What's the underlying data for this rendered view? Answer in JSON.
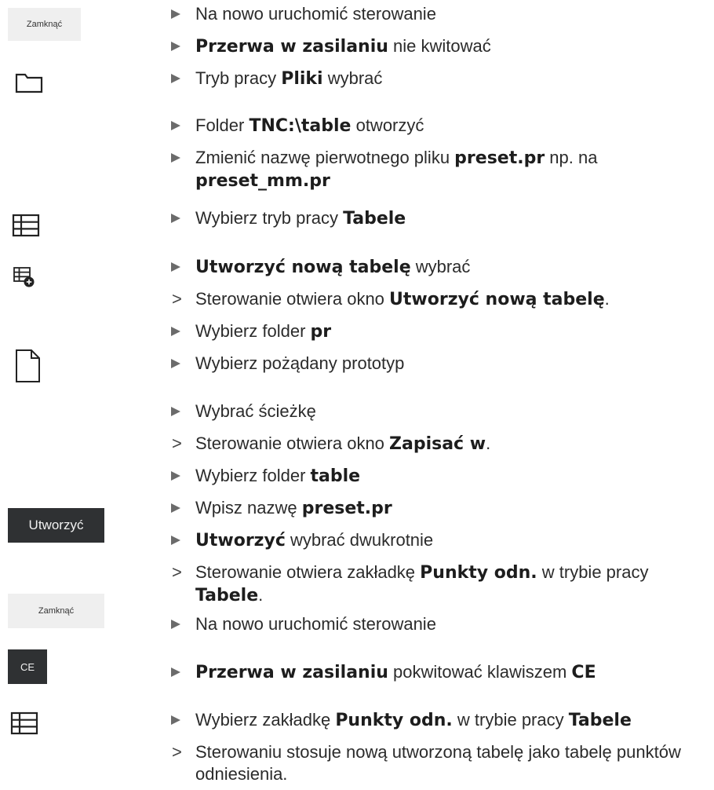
{
  "side_buttons": {
    "zamknac_1": "Zamknąć",
    "utworzyc": "Utworzyć",
    "zamknac_2": "Zamknąć",
    "ce": "CE"
  },
  "steps": [
    {
      "type": "action",
      "parts": [
        {
          "t": "Na nowo uruchomić sterowanie",
          "b": false
        }
      ]
    },
    {
      "type": "action",
      "parts": [
        {
          "t": "Przerwa w zasilaniu",
          "b": true
        },
        {
          "t": " nie kwitować",
          "b": false
        }
      ]
    },
    {
      "type": "action",
      "parts": [
        {
          "t": "Tryb pracy ",
          "b": false
        },
        {
          "t": "Pliki",
          "b": true
        },
        {
          "t": " wybrać",
          "b": false
        }
      ]
    },
    {
      "type": "action",
      "parts": [
        {
          "t": "Folder ",
          "b": false
        },
        {
          "t": "TNC:\\table",
          "b": true
        },
        {
          "t": " otworzyć",
          "b": false
        }
      ]
    },
    {
      "type": "action",
      "parts": [
        {
          "t": "Zmienić nazwę pierwotnego pliku ",
          "b": false
        },
        {
          "t": "preset.pr",
          "b": true
        },
        {
          "t": " np. na ",
          "b": false
        },
        {
          "t": "preset_mm.pr",
          "b": true
        }
      ]
    },
    {
      "type": "action",
      "parts": [
        {
          "t": "Wybierz tryb pracy ",
          "b": false
        },
        {
          "t": "Tabele",
          "b": true
        }
      ]
    },
    {
      "type": "action",
      "parts": [
        {
          "t": "Utworzyć nową tabelę",
          "b": true
        },
        {
          "t": " wybrać",
          "b": false
        }
      ]
    },
    {
      "type": "result",
      "parts": [
        {
          "t": "Sterowanie otwiera okno ",
          "b": false
        },
        {
          "t": "Utworzyć nową tabelę",
          "b": true
        },
        {
          "t": ".",
          "b": false
        }
      ]
    },
    {
      "type": "action",
      "parts": [
        {
          "t": "Wybierz folder ",
          "b": false
        },
        {
          "t": "pr",
          "b": true
        }
      ]
    },
    {
      "type": "action",
      "parts": [
        {
          "t": "Wybierz pożądany prototyp",
          "b": false
        }
      ]
    },
    {
      "type": "action",
      "parts": [
        {
          "t": "Wybrać ścieżkę",
          "b": false
        }
      ]
    },
    {
      "type": "result",
      "parts": [
        {
          "t": "Sterowanie otwiera okno ",
          "b": false
        },
        {
          "t": "Zapisać w",
          "b": true
        },
        {
          "t": ".",
          "b": false
        }
      ]
    },
    {
      "type": "action",
      "parts": [
        {
          "t": "Wybierz folder ",
          "b": false
        },
        {
          "t": "table",
          "b": true
        }
      ]
    },
    {
      "type": "action",
      "parts": [
        {
          "t": "Wpisz nazwę ",
          "b": false
        },
        {
          "t": "preset.pr",
          "b": true
        }
      ]
    },
    {
      "type": "action",
      "parts": [
        {
          "t": "Utworzyć",
          "b": true
        },
        {
          "t": " wybrać dwukrotnie",
          "b": false
        }
      ]
    },
    {
      "type": "result",
      "parts": [
        {
          "t": "Sterowanie otwiera zakładkę ",
          "b": false
        },
        {
          "t": "Punkty odn.",
          "b": true
        },
        {
          "t": " w trybie pracy ",
          "b": false
        },
        {
          "t": "Tabele",
          "b": true
        },
        {
          "t": ".",
          "b": false
        }
      ]
    },
    {
      "type": "action",
      "parts": [
        {
          "t": "Na nowo uruchomić sterowanie",
          "b": false
        }
      ]
    },
    {
      "type": "action",
      "parts": [
        {
          "t": "Przerwa w zasilaniu",
          "b": true
        },
        {
          "t": " pokwitować klawiszem ",
          "b": false
        },
        {
          "t": "CE",
          "b": true
        }
      ]
    },
    {
      "type": "action",
      "parts": [
        {
          "t": "Wybierz zakładkę ",
          "b": false
        },
        {
          "t": "Punkty odn.",
          "b": true
        },
        {
          "t": " w trybie pracy ",
          "b": false
        },
        {
          "t": "Tabele",
          "b": true
        }
      ]
    },
    {
      "type": "result",
      "parts": [
        {
          "t": "Sterowaniu stosuje nową utworzoną tabelę jako tabelę punktów odniesienia.",
          "b": false
        }
      ]
    }
  ]
}
